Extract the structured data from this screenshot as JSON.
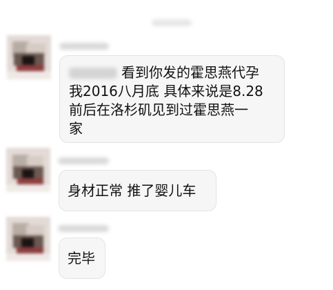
{
  "messages": [
    {
      "text": "看到你发的霍思燕代孕\n我2016八月底 具体来说是8.28\n前后在洛杉矶见到过霍思燕一\n家"
    },
    {
      "text": "身材正常 推了婴儿车"
    },
    {
      "text": "完毕"
    }
  ],
  "colors": {
    "background": "#ffffff",
    "bubble_bg": "#f6f6f6",
    "bubble_border": "#e3e3e3",
    "text": "#111111"
  }
}
